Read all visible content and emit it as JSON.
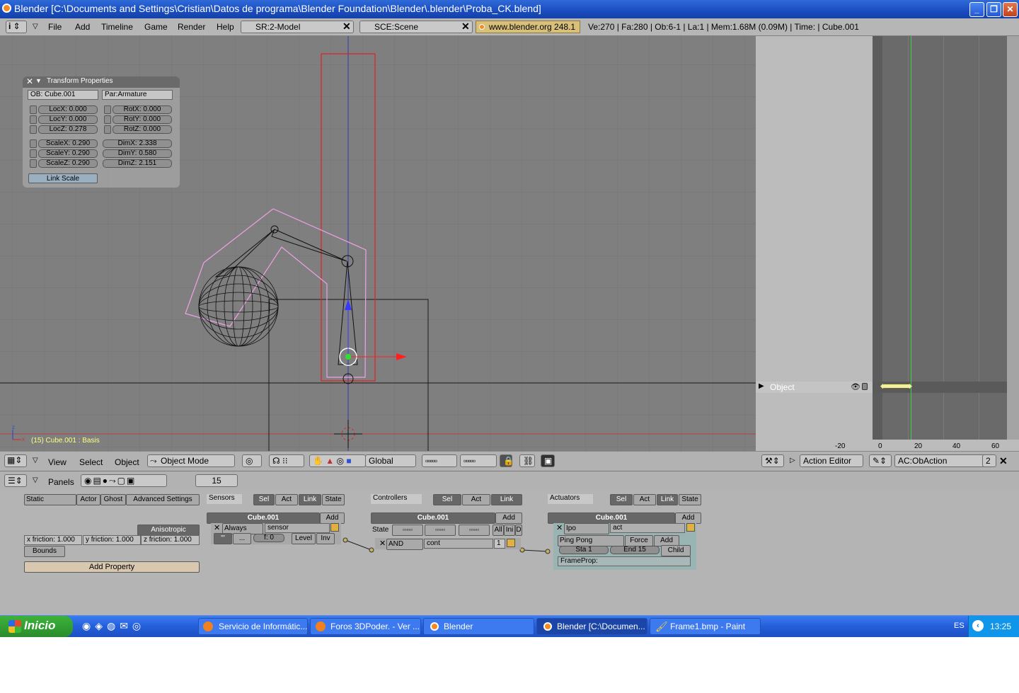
{
  "window": {
    "title": "Blender [C:\\Documents and Settings\\Cristian\\Datos de programa\\Blender Foundation\\Blender\\.blender\\Proba_CK.blend]"
  },
  "header": {
    "menus": [
      "File",
      "Add",
      "Timeline",
      "Game",
      "Render",
      "Help"
    ],
    "screen": "SR:2-Model",
    "scene": "SCE:Scene",
    "website": "www.blender.org 248.1",
    "stats": "Ve:270 | Fa:280 | Ob:6-1 | La:1  | Mem:1.68M (0.09M)  | Time: | Cube.001"
  },
  "transform": {
    "title": "Transform Properties",
    "ob": "OB: Cube.001",
    "par": "Par:Armature",
    "loc": [
      "LocX: 0.000",
      "LocY: 0.000",
      "LocZ: 0.278"
    ],
    "rot": [
      "RotX: 0.000",
      "RotY: 0.000",
      "RotZ: 0.000"
    ],
    "scale": [
      "ScaleX: 0.290",
      "ScaleY: 0.290",
      "ScaleZ: 0.290"
    ],
    "dim": [
      "DimX: 2.338",
      "DimY: 0.580",
      "DimZ: 2.151"
    ],
    "link_scale": "Link Scale"
  },
  "viewport": {
    "status": "(15) Cube.001 : Basis",
    "axis_x": "x",
    "axis_z": "z"
  },
  "vp_header": {
    "menus": [
      "View",
      "Select",
      "Object"
    ],
    "mode": "Object Mode",
    "orientation": "Global"
  },
  "action_editor": {
    "channel": "Object",
    "ticks": [
      "-20",
      "0",
      "20",
      "40",
      "60"
    ],
    "editor_type": "Action Editor",
    "action": "AC:ObAction",
    "users": "2"
  },
  "buttons_header": {
    "panels": "Panels",
    "frame": "15"
  },
  "physics": {
    "type": "Static",
    "tabs": [
      "Actor",
      "Ghost",
      "Advanced Settings"
    ],
    "anisotropic": "Anisotropic",
    "friction": [
      "x friction: 1.000",
      "y friction: 1.000",
      "z friction: 1.000"
    ],
    "bounds": "Bounds",
    "add_property": "Add Property"
  },
  "sensors": {
    "title": "Sensors",
    "tabs": [
      "Sel",
      "Act",
      "Link",
      "State"
    ],
    "object": "Cube.001",
    "add": "Add",
    "type": "Always",
    "name": "sensor",
    "freq": "f: 0",
    "level": "Level",
    "inv": "Inv"
  },
  "controllers": {
    "title": "Controllers",
    "tabs": [
      "Sel",
      "Act",
      "Link"
    ],
    "object": "Cube.001",
    "add": "Add",
    "state": "State",
    "all": "All",
    "ini": "Ini",
    "d": "D",
    "type": "AND",
    "name": "cont",
    "num": "1"
  },
  "actuators": {
    "title": "Actuators",
    "tabs": [
      "Sel",
      "Act",
      "Link",
      "State"
    ],
    "object": "Cube.001",
    "add": "Add",
    "type": "Ipo",
    "name": "act",
    "mode": "Ping Pong",
    "force": "Force",
    "add2": "Add",
    "sta": "Sta 1",
    "end": "End 15",
    "child": "Child",
    "frameprop": "FrameProp:"
  },
  "taskbar": {
    "start": "Inicio",
    "tasks": [
      "Servicio de Informátic...",
      "Foros 3DPoder. - Ver ...",
      "Blender",
      "Blender [C:\\Documen...",
      "Frame1.bmp - Paint"
    ],
    "lang": "ES",
    "clock": "13:25"
  }
}
